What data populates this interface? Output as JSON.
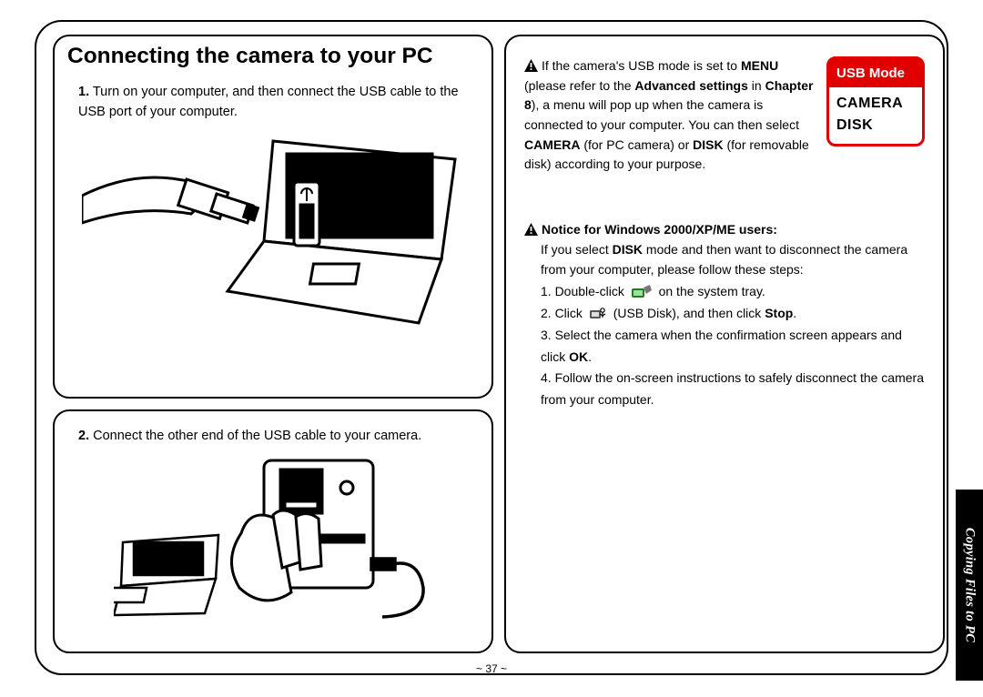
{
  "page_number": "~ 37 ~",
  "side_tab": "Copying Files to PC",
  "main_title": "Connecting the camera to your PC",
  "steps": {
    "s1_num": "1.",
    "s1_text": " Turn on your computer, and then connect the USB cable to the USB port of your computer.",
    "s2_num": "2.",
    "s2_text": " Connect the other end of the USB cable to your camera."
  },
  "right": {
    "p1a": "If the camera's USB mode is set to ",
    "p1b": "MENU",
    "p1c": " (please refer to the ",
    "p1d": "Advanced settings",
    "p1e": " in ",
    "p1f": "Chapter 8",
    "p1g": "), a menu will pop up when the camera is connected to your computer. You can then select ",
    "p1h": "CAMERA",
    "p1i": " (for PC camera) or ",
    "p1j": "DISK",
    "p1k": " (for removable disk) according to your purpose.",
    "usb_mode_header": "USB Mode",
    "usb_opt1": "CAMERA",
    "usb_opt2": "DISK",
    "notice_title": "Notice for Windows 2000/XP/ME users:",
    "notice_body_a": "If you select ",
    "notice_body_b": "DISK",
    "notice_body_c": " mode and then want to disconnect the camera from your computer, please follow these steps:",
    "st1a": "1. Double-click ",
    "st1b": " on the system tray.",
    "st2a": "2. Click ",
    "st2b": " (USB Disk), and then click ",
    "st2c": "Stop",
    "st2d": ".",
    "st3": "3. Select the camera when the confirmation screen appears and click ",
    "st3b": "OK",
    "st3c": ".",
    "st4": "4. Follow the on-screen instructions to safely disconnect the camera from your computer."
  }
}
